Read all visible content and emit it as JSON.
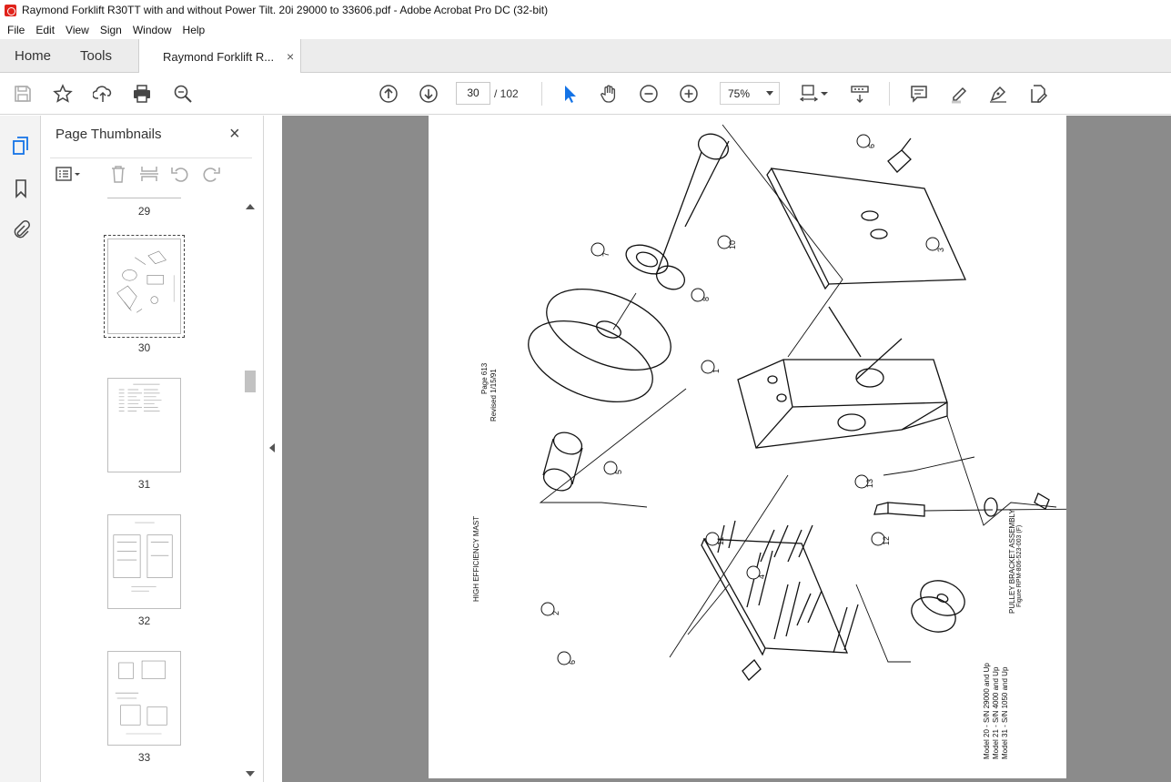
{
  "window": {
    "title": "Raymond Forklift R30TT with and without Power Tilt. 20i 29000 to 33606.pdf - Adobe Acrobat Pro DC (32-bit)"
  },
  "menu": [
    "File",
    "Edit",
    "View",
    "Sign",
    "Window",
    "Help"
  ],
  "tabs": {
    "home": "Home",
    "tools": "Tools",
    "document": "Raymond Forklift R...",
    "close": "×"
  },
  "toolbar": {
    "current_page": "30",
    "page_total": "/ 102",
    "zoom": "75%"
  },
  "thumbnails_panel": {
    "title": "Page Thumbnails",
    "close": "×",
    "pages": [
      "29",
      "30",
      "31",
      "32",
      "33"
    ],
    "selected_page": "30"
  },
  "pdf_page": {
    "page_number": "Page 613",
    "revised": "Revised 1/15/91",
    "section": "HIGH EFFICIENCY MAST",
    "assembly_title": "PULLEY BRACKET ASSEMBLY",
    "figure": "Figure RPM-806-523-003 (F)",
    "models": [
      "Model 20 - S/N 29000 and Up",
      "Model 21 - S/N 4000 and Up",
      "Model 31 - S/N 1050 and Up"
    ],
    "callouts": [
      "1",
      "2",
      "3",
      "4",
      "5",
      "6",
      "6",
      "7",
      "8",
      "10",
      "11",
      "12",
      "13"
    ]
  },
  "colors": {
    "viewer_bg": "#8b8b8b",
    "tab_bg": "#ececec",
    "accent_blue": "#1473e6"
  }
}
